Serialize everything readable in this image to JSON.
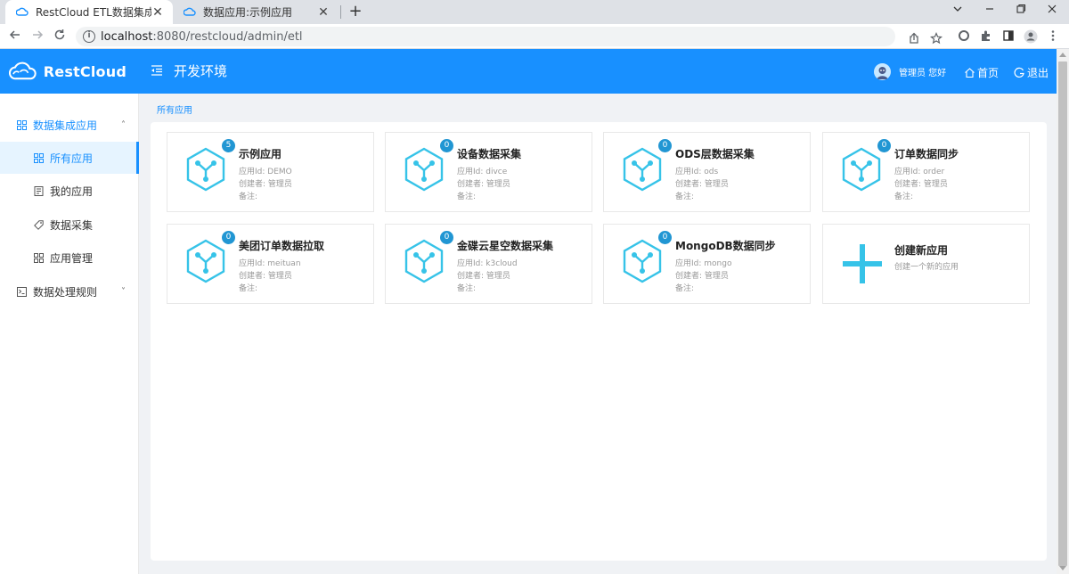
{
  "browser": {
    "tabs": [
      {
        "title": "RestCloud ETL数据集成平台",
        "close": "✕"
      },
      {
        "title": "数据应用:示例应用",
        "close": "✕"
      }
    ],
    "new_tab": "+",
    "url_host": "localhost",
    "url_rest": ":8080/restcloud/admin/etl"
  },
  "header": {
    "logo_text": "RestCloud",
    "env_title": "开发环境",
    "user_label": "管理员 您好",
    "home_label": "首页",
    "logout_label": "退出",
    "brand_color": "#1890ff"
  },
  "sidebar": {
    "items": [
      {
        "label": "数据集成应用",
        "icon": "grid-icon",
        "arrow": "˄"
      },
      {
        "label": "所有应用",
        "icon": "grid-icon"
      },
      {
        "label": "我的应用",
        "icon": "book-icon"
      },
      {
        "label": "数据采集",
        "icon": "tag-icon"
      },
      {
        "label": "应用管理",
        "icon": "grid-icon"
      },
      {
        "label": "数据处理规则",
        "icon": "terminal-icon",
        "arrow": "˅"
      }
    ]
  },
  "breadcrumb": "所有应用",
  "apps": [
    {
      "name": "示例应用",
      "count": "5",
      "id_line": "应用Id: DEMO",
      "creator_line": "创建者: 管理员",
      "note_line": "备注:"
    },
    {
      "name": "设备数据采集",
      "count": "0",
      "id_line": "应用Id: divce",
      "creator_line": "创建者: 管理员",
      "note_line": "备注:"
    },
    {
      "name": "ODS层数据采集",
      "count": "0",
      "id_line": "应用Id: ods",
      "creator_line": "创建者: 管理员",
      "note_line": "备注:"
    },
    {
      "name": "订单数据同步",
      "count": "0",
      "id_line": "应用Id: order",
      "creator_line": "创建者: 管理员",
      "note_line": "备注:"
    },
    {
      "name": "美团订单数据拉取",
      "count": "0",
      "id_line": "应用Id: meituan",
      "creator_line": "创建者: 管理员",
      "note_line": "备注:"
    },
    {
      "name": "金碟云星空数据采集",
      "count": "0",
      "id_line": "应用Id: k3cloud",
      "creator_line": "创建者: 管理员",
      "note_line": "备注:"
    },
    {
      "name": "MongoDB数据同步",
      "count": "0",
      "id_line": "应用Id: mongo",
      "creator_line": "创建者: 管理员",
      "note_line": "备注:"
    }
  ],
  "create_card": {
    "title": "创建新应用",
    "desc": "创建一个新的应用"
  }
}
